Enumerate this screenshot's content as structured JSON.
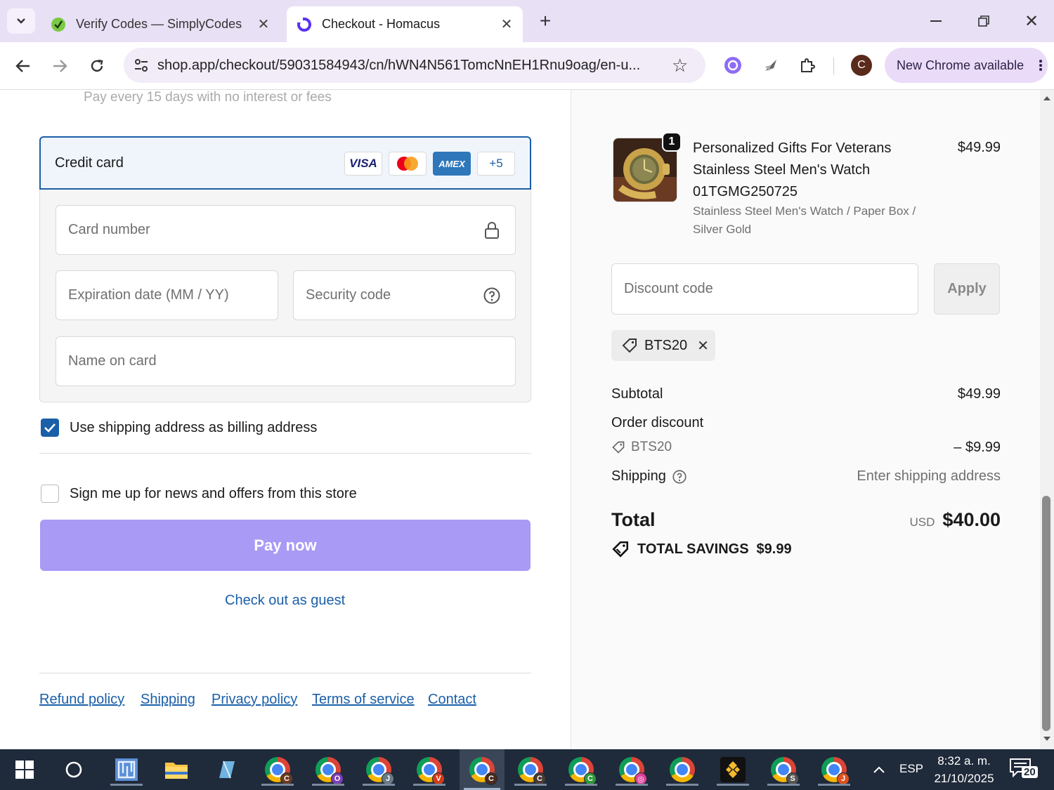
{
  "browser": {
    "tabs": [
      {
        "label": "Verify Codes — SimplyCodes",
        "icon": "simplycodes-icon"
      },
      {
        "label": "Checkout - Homacus",
        "icon": "shop-icon"
      }
    ],
    "url": "shop.app/checkout/59031584943/cn/hWN4N561TomcNnEH1Rnu9oag/en-u...",
    "new_chrome_label": "New Chrome available",
    "profile_initial": "C"
  },
  "checkout": {
    "installment_note": "Pay every 15 days with no interest or fees",
    "payment_method": {
      "label": "Credit card",
      "logos": [
        "VISA",
        "AMEX",
        "+5"
      ]
    },
    "fields": {
      "card_number": "Card number",
      "expiration": "Expiration date (MM / YY)",
      "security_code": "Security code",
      "name_on_card": "Name on card"
    },
    "billing_same_label": "Use shipping address as billing address",
    "newsletter_label": "Sign me up for news and offers from this store",
    "pay_button": "Pay now",
    "guest_link": "Check out as guest",
    "footer_links": [
      "Refund policy",
      "Shipping",
      "Privacy policy",
      "Terms of service",
      "Contact"
    ]
  },
  "summary": {
    "product": {
      "quantity": "1",
      "name_lines": [
        "Personalized Gifts For Veterans",
        "Stainless Steel Men's Watch",
        "01TGMG250725"
      ],
      "variant_lines": [
        "Stainless Steel Men's Watch / Paper Box /",
        "Silver Gold"
      ],
      "price": "$49.99"
    },
    "discount_placeholder": "Discount code",
    "apply_label": "Apply",
    "applied_code": "BTS20",
    "subtotal_label": "Subtotal",
    "subtotal_value": "$49.99",
    "order_discount_label": "Order discount",
    "discount_code": "BTS20",
    "discount_value": "– $9.99",
    "shipping_label": "Shipping",
    "shipping_value": "Enter shipping address",
    "total_label": "Total",
    "total_currency": "USD",
    "total_value": "$40.00",
    "savings_label": "TOTAL SAVINGS",
    "savings_value": "$9.99"
  },
  "taskbar": {
    "badges": [
      "C",
      "O",
      "J",
      "V",
      "C",
      "C",
      "C",
      "S",
      "J"
    ],
    "lang": "ESP",
    "time": "8:32 a. m.",
    "date": "21/10/2025",
    "notifications": "20"
  },
  "colors": {
    "accent": "#1a5fa8",
    "pay_button": "#a89af5",
    "checkbox": "#1a5fa8",
    "tabstrip": "#e8e0f5"
  }
}
